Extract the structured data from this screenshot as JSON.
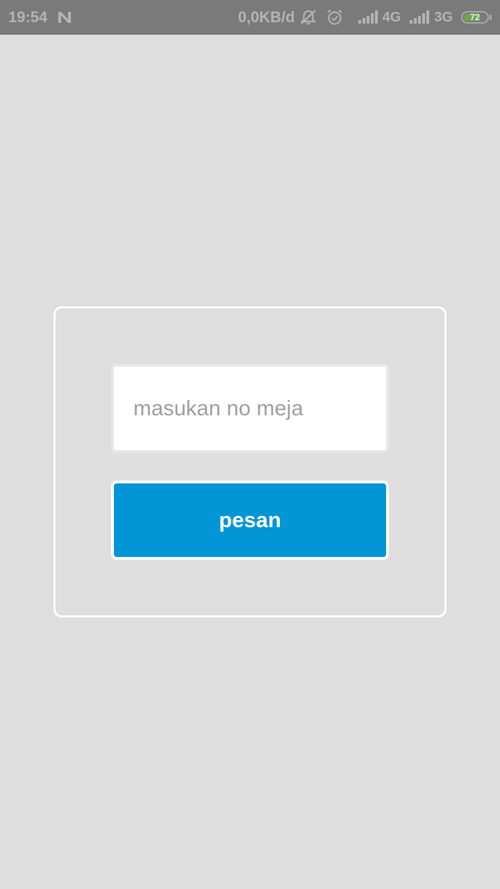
{
  "status_bar": {
    "time": "19:54",
    "data_rate": "0,0KB/d",
    "network_1": "4G",
    "network_2": "3G",
    "battery_level": "72",
    "battery_fraction": 0.72,
    "icons": [
      "n-notification-icon",
      "bell-off-icon",
      "alarm-clock-icon",
      "signal-icon",
      "signal-icon",
      "battery-icon"
    ],
    "colors": {
      "background": "#7a7a7a",
      "text": "#b4b4b4",
      "battery_fill": "#6aa84f"
    }
  },
  "form": {
    "table_number_value": "",
    "table_number_placeholder": "masukan no meja",
    "order_button_label": "pesan"
  },
  "colors": {
    "page_background": "#dedede",
    "card_border": "#ffffff",
    "button_background": "#0396d6",
    "button_text": "#ffffff",
    "placeholder_text": "#9e9e9e"
  }
}
